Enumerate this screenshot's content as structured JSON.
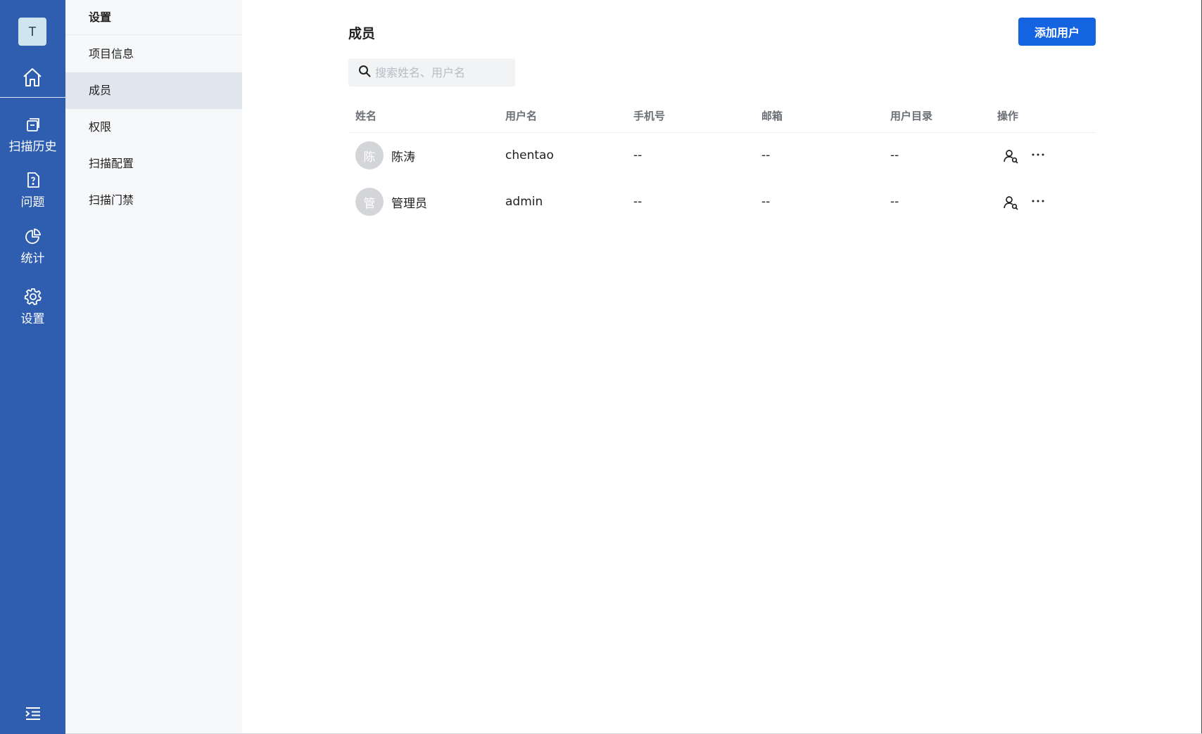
{
  "rail": {
    "avatar_letter": "T",
    "items": [
      {
        "label": "扫描历史",
        "icon": "scan-history-icon"
      },
      {
        "label": "问题",
        "icon": "issue-file-icon"
      },
      {
        "label": "统计",
        "icon": "pie-chart-icon"
      },
      {
        "label": "设置",
        "icon": "gear-icon"
      }
    ]
  },
  "subnav": {
    "title": "设置",
    "items": [
      {
        "label": "项目信息",
        "active": false
      },
      {
        "label": "成员",
        "active": true
      },
      {
        "label": "权限",
        "active": false
      },
      {
        "label": "扫描配置",
        "active": false
      },
      {
        "label": "扫描门禁",
        "active": false
      }
    ]
  },
  "main": {
    "title": "成员",
    "add_button": "添加用户",
    "search": {
      "placeholder": "搜索姓名、用户名",
      "value": ""
    },
    "table": {
      "columns": [
        "姓名",
        "用户名",
        "手机号",
        "邮箱",
        "用户目录",
        "操作"
      ],
      "rows": [
        {
          "avatar": "陈",
          "name": "陈涛",
          "username": "chentao",
          "phone": "--",
          "email": "--",
          "directory": "--"
        },
        {
          "avatar": "管",
          "name": "管理员",
          "username": "admin",
          "phone": "--",
          "email": "--",
          "directory": "--"
        }
      ]
    }
  },
  "colors": {
    "rail": "#2f5eb0",
    "accent": "#1463e0",
    "subnav_bg": "#f7f8fa",
    "subnav_active": "#e1e5ee"
  }
}
